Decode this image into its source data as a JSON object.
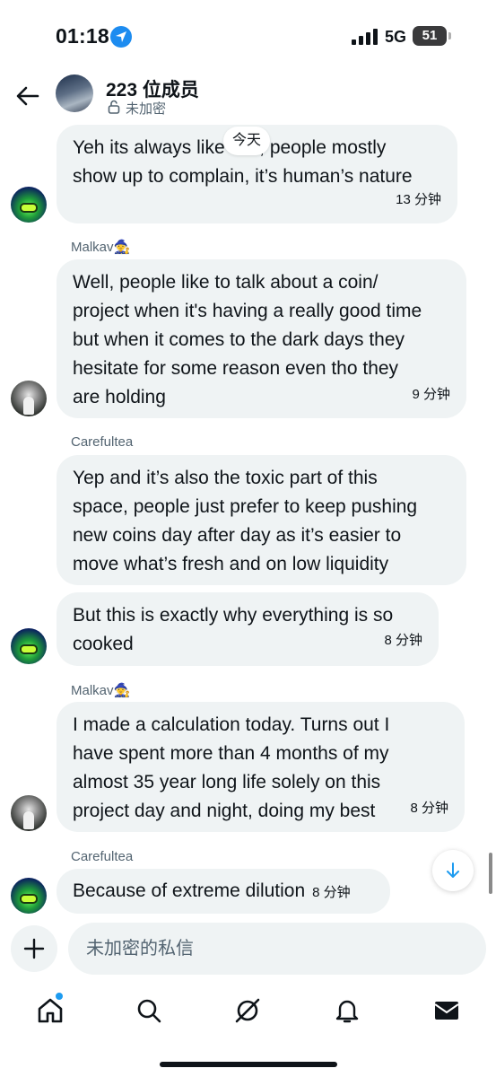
{
  "status_bar": {
    "time": "01:18",
    "network": "5G",
    "battery": "51"
  },
  "header": {
    "title": "223 位成员",
    "subtitle": "未加密"
  },
  "date_divider": "今天",
  "messages": [
    {
      "text": "Yeh its always like this, people mostly\nshow up to complain, it’s human’s nature",
      "time": "13 分钟"
    },
    {
      "sender": "Malkav🧙",
      "text": "Well, people like to talk about a coin/\nproject when it's having a really good time\nbut when it comes to the dark days they\nhesitate for some reason even tho they\nare holding",
      "time": "9 分钟"
    },
    {
      "sender": "Carefultea",
      "text": "Yep and it’s also the toxic part of this\nspace, people just prefer to keep pushing\nnew coins day after day as it’s easier to\nmove what’s fresh and on low liquidity"
    },
    {
      "text": "But this is exactly why everything is so\ncooked",
      "time": "8 分钟"
    },
    {
      "sender": "Malkav🧙",
      "text": "I made a calculation today. Turns out I\nhave spent more than  4 months of my\nalmost 35 year long life solely on this\nproject day and night, doing my best",
      "time": "8 分钟"
    },
    {
      "sender": "Carefultea",
      "text": "Because of extreme dilution",
      "time": "8 分钟"
    }
  ],
  "composer": {
    "placeholder": "未加密的私信"
  },
  "icons": {
    "back": "back-arrow-icon",
    "lock": "lock-icon",
    "add": "plus-icon",
    "scroll": "arrow-down-icon",
    "tabs": [
      "home-icon",
      "search-icon",
      "grok-icon",
      "bell-icon",
      "mail-icon"
    ]
  },
  "colors": {
    "accent": "#1d9bf0",
    "bubble": "#eff3f4",
    "muted": "#536471"
  }
}
